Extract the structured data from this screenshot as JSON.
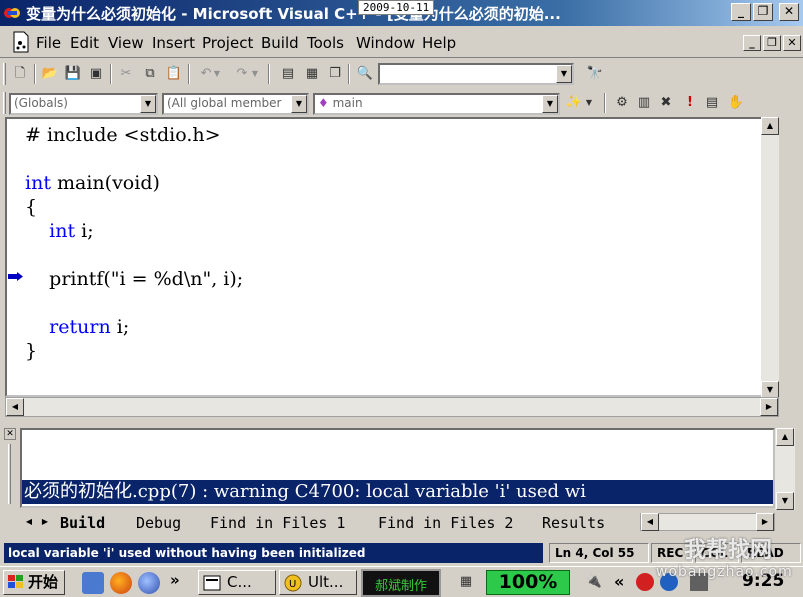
{
  "window": {
    "title": "变量为什么必须初始化 - Microsoft Visual C++ - [变量为什么必须的初始...",
    "date_stamp": "2009-10-11",
    "buttons": {
      "minimize": "_",
      "restore": "❐",
      "close": "✕"
    }
  },
  "menu": {
    "items": [
      "File",
      "Edit",
      "View",
      "Insert",
      "Project",
      "Build",
      "Tools",
      "Window",
      "Help"
    ],
    "mdi_buttons": {
      "minimize": "_",
      "restore": "❐",
      "close": "✕"
    }
  },
  "toolbar": {
    "find_combo_value": ""
  },
  "wizard_bar": {
    "class_combo": "(Globals)",
    "members_combo": "(All global member",
    "function_combo": "main"
  },
  "editor": {
    "lines": [
      {
        "kw": "",
        "rest": "",
        "pre": "# include <stdio.h>"
      },
      {
        "kw": "",
        "rest": "",
        "pre": ""
      },
      {
        "kw": "int",
        "rest": " main(void)",
        "pre": ""
      },
      {
        "kw": "",
        "rest": "",
        "pre": "{"
      },
      {
        "kw": "int",
        "rest": " i;",
        "pre": "    "
      },
      {
        "kw": "",
        "rest": "",
        "pre": ""
      },
      {
        "kw": "",
        "rest": "",
        "pre": "    printf(\"i = %d\\n\", i);"
      },
      {
        "kw": "",
        "rest": "",
        "pre": ""
      },
      {
        "kw": "return",
        "rest": " i;",
        "pre": "    "
      },
      {
        "kw": "",
        "rest": "",
        "pre": "}"
      }
    ]
  },
  "output": {
    "message": "必须的初始化.cpp(7) : warning C4700: local variable 'i' used wi"
  },
  "output_tabs": [
    "Build",
    "Debug",
    "Find in Files 1",
    "Find in Files 2",
    "Results"
  ],
  "status": {
    "message": "local variable 'i' used without having been initialized",
    "position": "Ln 4, Col 55",
    "rec": "REC",
    "col": "COL",
    "read": "READ"
  },
  "taskbar": {
    "start_label": "开始",
    "more_label": "»",
    "tasks": [
      {
        "label": "C..."
      },
      {
        "label": "Ult..."
      }
    ],
    "maker_label": "郝斌制作",
    "zoom_label": "100%",
    "tray_more": "«",
    "clock": "9:25"
  },
  "watermark": {
    "name": "我帮找网",
    "url": "wobangzhao.com"
  },
  "colors": {
    "title_start": "#0a246a",
    "keyword": "#0000ff",
    "selection": "#0a246a",
    "zoom_badge": "#2cc94a"
  }
}
